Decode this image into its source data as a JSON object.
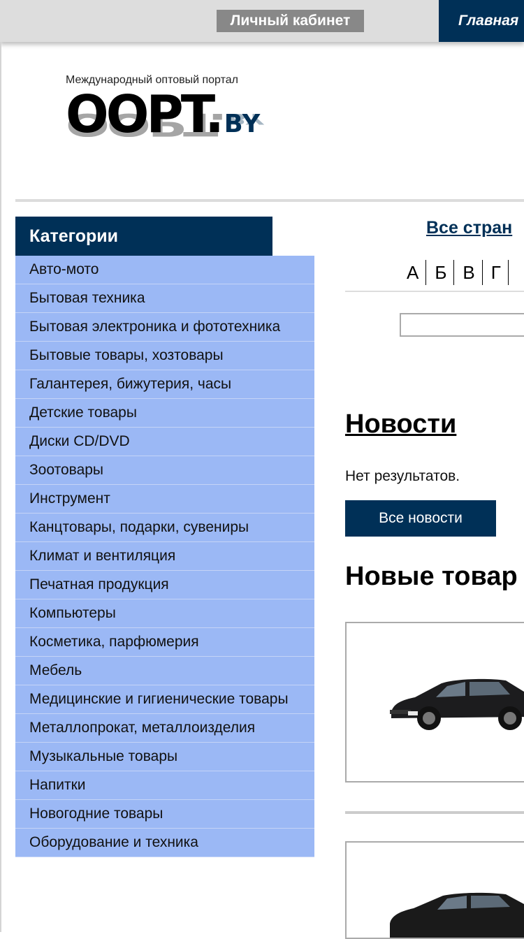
{
  "topbar": {
    "cabinet_label": "Личный кабинет",
    "home_label": "Главная"
  },
  "logo": {
    "tagline": "Международный оптовый портал",
    "word": "OOPT.",
    "tld": "BY"
  },
  "categories": {
    "title": "Категории",
    "items": [
      "Авто-мото",
      "Бытовая техника",
      "Бытовая электроника и фототехника",
      "Бытовые товары, хозтовары",
      "Галантерея, бижутерия, часы",
      "Детские товары",
      "Диски CD/DVD",
      "Зоотовары",
      "Инструмент",
      "Канцтовары, подарки, сувениры",
      "Климат и вентиляция",
      "Печатная продукция",
      "Компьютеры",
      "Косметика, парфюмерия",
      "Мебель",
      "Медицинские и гигиенические товары",
      "Металлопрокат, металлоизделия",
      "Музыкальные товары",
      "Напитки",
      "Новогодние товары",
      "Оборудование и техника"
    ]
  },
  "countries": {
    "all_label": "Все стран",
    "letters": [
      "А",
      "Б",
      "В",
      "Г"
    ]
  },
  "news": {
    "title": "Новости",
    "empty": "Нет результатов.",
    "all_button": "Все новости"
  },
  "new_goods": {
    "title": "Новые товар"
  },
  "colors": {
    "navy": "#003057",
    "category_bg": "#9bb8f5",
    "topbar_bg": "#dddddd"
  }
}
